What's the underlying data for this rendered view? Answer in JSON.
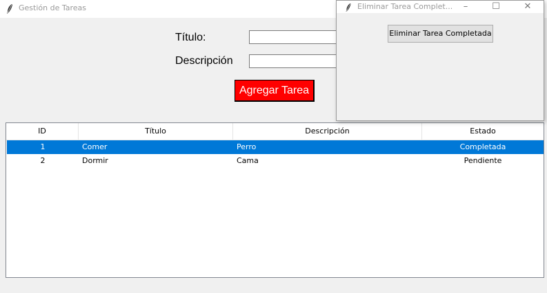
{
  "main_window": {
    "title": "Gestión de Tareas",
    "icon": "feather-icon"
  },
  "form": {
    "title_label": "Título:",
    "title_value": "",
    "description_label": "Descripción",
    "description_value": "",
    "add_button_label": "Agregar Tarea",
    "add_button_color": "#ff0000"
  },
  "table": {
    "columns": [
      "ID",
      "Título",
      "Descripción",
      "Estado"
    ],
    "rows": [
      {
        "id": "1",
        "titulo": "Comer",
        "descripcion": "Perro",
        "estado": "Completada",
        "selected": true
      },
      {
        "id": "2",
        "titulo": "Dormir",
        "descripcion": "Cama",
        "estado": "Pendiente",
        "selected": false
      }
    ],
    "selection_color": "#0078d7"
  },
  "popup": {
    "title": "Eliminar Tarea Complet...",
    "icon": "feather-icon",
    "button_label": "Eliminar Tarea Completada",
    "controls": {
      "minimize": "–",
      "maximize": "☐",
      "close": "✕"
    }
  }
}
